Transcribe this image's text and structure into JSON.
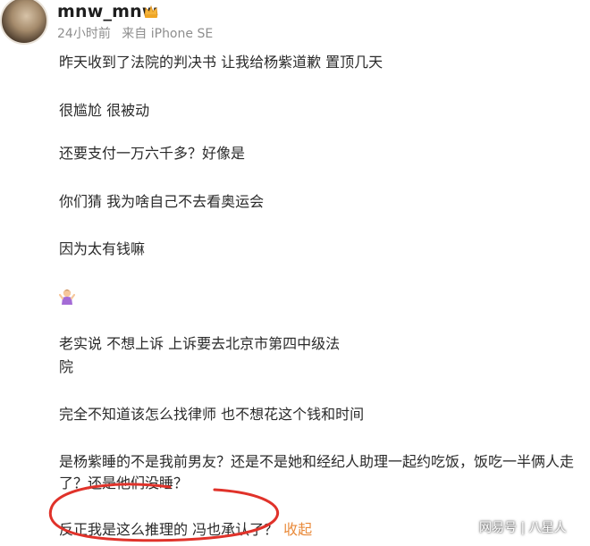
{
  "header": {
    "username": "mnw_mnw",
    "time": "24小时前",
    "source": "来自 iPhone SE"
  },
  "post": {
    "line1": "昨天收到了法院的判决书 让我给杨紫道歉 置顶几天",
    "line2": "很尴尬 很被动",
    "line3": "还要支付一万六千多？好像是",
    "line4": "你们猜 我为啥自己不去看奥运会",
    "line5": "因为太有钱嘛",
    "line6a": "老实说 不想上诉 上诉要去北京市第四中级法",
    "line6b": "院",
    "line7": "完全不知道该怎么找律师 也不想花这个钱和时间",
    "line8a": "是杨紫睡的不是我前男友？还是不是她和经纪人助理一起约吃饭，饭吃一半俩人走",
    "line8b": "了？还是他们没睡？",
    "line9": "反正我是这么推理的 冯也承认了？",
    "collapse": "收起"
  },
  "icons": {
    "crown": "crown-icon",
    "emoji": "shrugging-person-emoji-icon"
  },
  "watermark": "网易号 | 八星人",
  "colors": {
    "annotation_circle": "#e0322a",
    "collapse_link": "#e98a3a"
  }
}
